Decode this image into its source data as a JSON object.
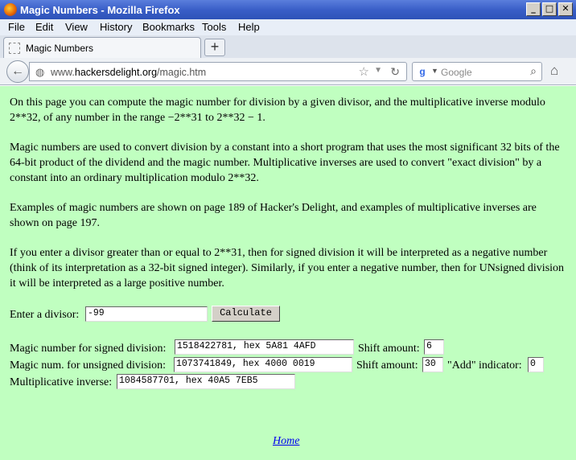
{
  "window": {
    "title": "Magic Numbers - Mozilla Firefox",
    "minimize": "_",
    "maximize": "□",
    "close": "✕"
  },
  "menu": [
    "File",
    "Edit",
    "View",
    "History",
    "Bookmarks",
    "Tools",
    "Help"
  ],
  "tab": {
    "label": "Magic Numbers",
    "new_tab": "+"
  },
  "nav": {
    "url_prefix": "www.",
    "url_domain": "hackersdelight.org",
    "url_path": "/magic.htm",
    "search_placeholder": "Google"
  },
  "content": {
    "p1": "On this page you can compute the magic number for division by a given divisor, and the multiplicative inverse modulo 2**32, of any number in the range −2**31 to 2**32 − 1.",
    "p2": "Magic numbers are used to convert division by a constant into a short program that uses the most significant 32 bits of the 64-bit product of the dividend and the magic number. Multiplicative inverses are used to convert \"exact division\" by a constant into an ordinary multiplication modulo 2**32.",
    "p3": "Examples of magic numbers are shown on page 189 of Hacker's Delight, and examples of multiplicative inverses are shown on page 197.",
    "p4": "If you enter a divisor greater than or equal to 2**31, then for signed division it will be interpreted as a negative number (think of its interpretation as a 32-bit signed integer). Similarly, if you enter a negative number, then for UNsigned division it will be interpreted as a large positive number.",
    "divisor_label": "Enter a divisor:",
    "divisor_value": "-99",
    "calculate_label": "Calculate",
    "signed_label": "Magic number for signed division:",
    "signed_value": "1518422781, hex 5A81 4AFD",
    "signed_shift_label": "Shift amount:",
    "signed_shift_value": "6",
    "unsigned_label": "Magic num. for unsigned division:",
    "unsigned_value": "1073741849, hex 4000 0019",
    "unsigned_shift_label": "Shift amount:",
    "unsigned_shift_value": "30",
    "add_label": "\"Add\" indicator:",
    "add_value": "0",
    "inverse_label": "Multiplicative inverse:",
    "inverse_value": "1084587701, hex 40A5 7EB5",
    "home_link": "Home"
  }
}
